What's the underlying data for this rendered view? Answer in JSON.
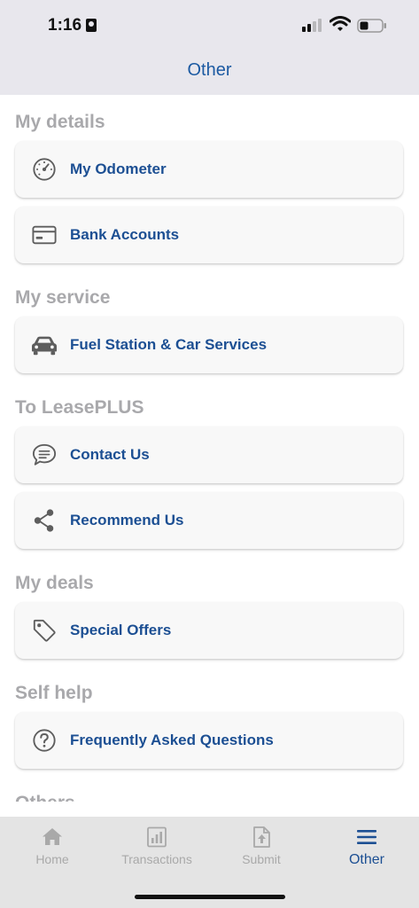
{
  "status": {
    "time": "1:16"
  },
  "header": {
    "title": "Other"
  },
  "sections": [
    {
      "title": "My details",
      "items": [
        {
          "label": "My Odometer",
          "icon": "gauge-icon"
        },
        {
          "label": "Bank Accounts",
          "icon": "card-icon"
        }
      ]
    },
    {
      "title": "My service",
      "items": [
        {
          "label": "Fuel Station & Car Services",
          "icon": "car-icon"
        }
      ]
    },
    {
      "title": "To LeasePLUS",
      "items": [
        {
          "label": "Contact Us",
          "icon": "chat-icon"
        },
        {
          "label": "Recommend Us",
          "icon": "share-icon"
        }
      ]
    },
    {
      "title": "My deals",
      "items": [
        {
          "label": "Special Offers",
          "icon": "tag-icon"
        }
      ]
    },
    {
      "title": "Self help",
      "items": [
        {
          "label": "Frequently Asked Questions",
          "icon": "question-icon"
        }
      ]
    },
    {
      "title": "Others",
      "items": []
    }
  ],
  "tabs": [
    {
      "label": "Home",
      "icon": "home-icon",
      "active": false
    },
    {
      "label": "Transactions",
      "icon": "chart-icon",
      "active": false
    },
    {
      "label": "Submit",
      "icon": "upload-doc-icon",
      "active": false
    },
    {
      "label": "Other",
      "icon": "menu-icon",
      "active": true
    }
  ],
  "colors": {
    "accent": "#1c4f93",
    "section_title": "#a9a9ac",
    "header_bg": "#e8e7ed",
    "tabbar_bg": "#e4e4e4"
  }
}
